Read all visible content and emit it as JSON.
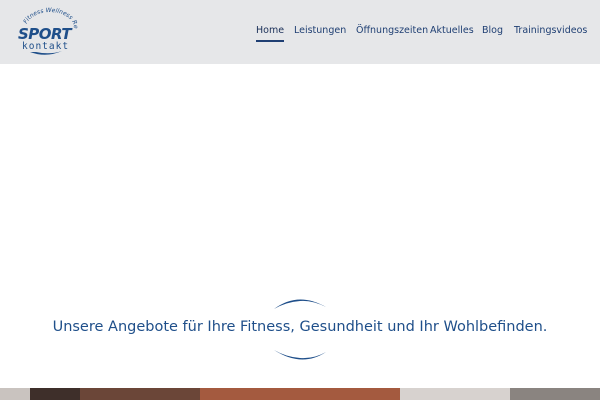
{
  "brand": {
    "arc_text": "Fitness Wellness Reha",
    "line1": "SPORT",
    "line2": "kontakt",
    "primary_color": "#1f4f8a",
    "header_bg": "#e6e7e9"
  },
  "nav": {
    "items": [
      {
        "label": "Home",
        "active": true
      },
      {
        "label": "Leistungen",
        "active": false
      },
      {
        "label": "Öffnungszeiten",
        "active": false
      },
      {
        "label": "Aktuelles",
        "active": false
      },
      {
        "label": "Blog",
        "active": false
      },
      {
        "label": "Trainingsvideos",
        "active": false
      }
    ]
  },
  "hero": {
    "tagline": "Unsere Angebote für Ihre Fitness, Gesundheit und Ihr Wohlbefinden."
  }
}
